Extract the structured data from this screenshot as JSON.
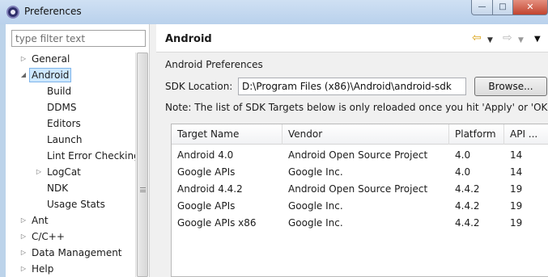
{
  "window": {
    "title": "Preferences",
    "minimize": "—",
    "maximize": "□",
    "close": "✕"
  },
  "sidebar": {
    "filter_placeholder": "type filter text",
    "items": [
      {
        "label": "General",
        "arrow": "▷"
      },
      {
        "label": "Android",
        "arrow": "◢"
      },
      {
        "label": "Build",
        "arrow": ""
      },
      {
        "label": "DDMS",
        "arrow": ""
      },
      {
        "label": "Editors",
        "arrow": ""
      },
      {
        "label": "Launch",
        "arrow": ""
      },
      {
        "label": "Lint Error Checking",
        "arrow": ""
      },
      {
        "label": "LogCat",
        "arrow": "▷"
      },
      {
        "label": "NDK",
        "arrow": ""
      },
      {
        "label": "Usage Stats",
        "arrow": ""
      },
      {
        "label": "Ant",
        "arrow": "▷"
      },
      {
        "label": "C/C++",
        "arrow": "▷"
      },
      {
        "label": "Data Management",
        "arrow": "▷"
      },
      {
        "label": "Help",
        "arrow": "▷"
      }
    ]
  },
  "header": {
    "title": "Android",
    "back_icon": "⇦",
    "back_menu_icon": "▼",
    "forward_icon": "⇨",
    "forward_menu_icon": "▼",
    "view_menu_icon": "▼"
  },
  "main": {
    "section_title": "Android Preferences",
    "sdk_location_label": "SDK Location:",
    "sdk_location_value": "D:\\Program Files (x86)\\Android\\android-sdk",
    "browse_label": "Browse...",
    "note": "Note: The list of SDK Targets below is only reloaded once you hit 'Apply' or 'OK'."
  },
  "table": {
    "columns": [
      "Target Name",
      "Vendor",
      "Platform",
      "API ..."
    ],
    "rows": [
      [
        "Android 4.0",
        "Android Open Source Project",
        "4.0",
        "14"
      ],
      [
        "Google APIs",
        "Google Inc.",
        "4.0",
        "14"
      ],
      [
        "Android 4.4.2",
        "Android Open Source Project",
        "4.4.2",
        "19"
      ],
      [
        "Google APIs",
        "Google Inc.",
        "4.4.2",
        "19"
      ],
      [
        "Google APIs x86",
        "Google Inc.",
        "4.4.2",
        "19"
      ]
    ]
  }
}
